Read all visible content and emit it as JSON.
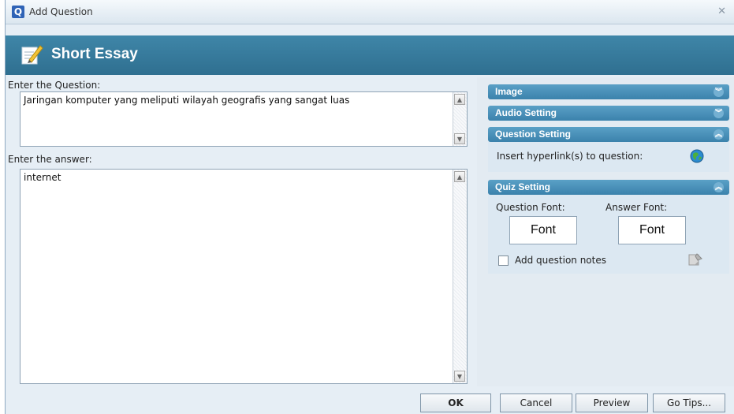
{
  "window": {
    "title": "Add Question"
  },
  "header": {
    "title": "Short Essay"
  },
  "question": {
    "label": "Enter the Question:",
    "value": "Jaringan komputer yang meliputi wilayah geografis yang sangat luas"
  },
  "answer": {
    "label": "Enter the answer:",
    "value": "internet"
  },
  "side": {
    "image": "Image",
    "audio": "Audio Setting",
    "question_setting": "Question Setting",
    "hyperlink_label": "Insert hyperlink(s) to question:",
    "quiz_setting": "Quiz Setting",
    "question_font_label": "Question Font:",
    "answer_font_label": "Answer Font:",
    "font_button": "Font",
    "notes_label": "Add question notes"
  },
  "buttons": {
    "ok": "OK",
    "cancel": "Cancel",
    "preview": "Preview",
    "tips": "Go Tips..."
  },
  "colors": {
    "banner": "#3f86a8",
    "section_header": "#4a91ba"
  },
  "icons": {
    "app": "app-logo-icon",
    "banner": "essay-pencil-icon",
    "hyperlink": "globe-icon",
    "notes": "note-icon"
  }
}
